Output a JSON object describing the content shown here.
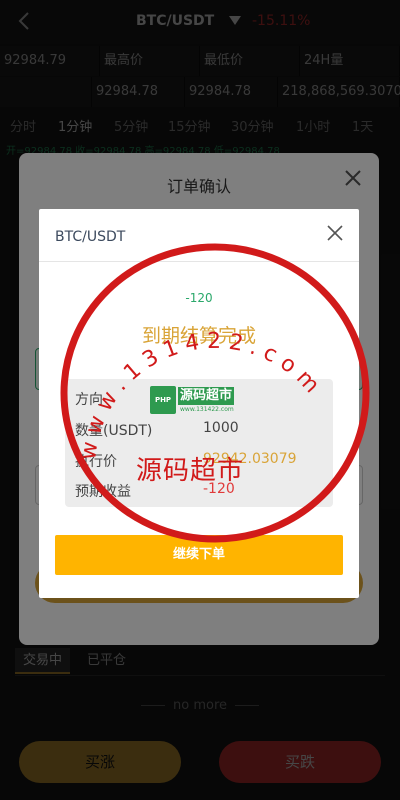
{
  "header": {
    "pair": "BTC/USDT",
    "change": "-15.11%"
  },
  "stats_row1": [
    "92984.79",
    "最高价",
    "最低价",
    "24H量"
  ],
  "stats_row2": [
    "92984.78",
    "92984.78",
    "218,868,569.3070"
  ],
  "periods": [
    "分时",
    "1分钟",
    "5分钟",
    "15分钟",
    "30分钟",
    "1小时",
    "1天"
  ],
  "active_period": "1分钟",
  "ma_row": "开=92984.78   收=92984.78   高=92984.78   低=92984.78",
  "confirm_modal": {
    "title": "订单确认"
  },
  "result_modal": {
    "title": "BTC/USDT",
    "profit_small": "-120",
    "status": "到期结算完成",
    "details": {
      "direction_label": "方向",
      "quantity_label": "数量(USDT)",
      "quantity_value": "1000",
      "price_label": "执行价",
      "price_value": "92942.03079",
      "profit_label": "预期收益",
      "profit_value": "-120"
    },
    "continue_label": "继续下单"
  },
  "orders": {
    "tab_trading": "交易中",
    "tab_closed": "已平仓",
    "no_more": "no more"
  },
  "bottom": {
    "buy_up": "买涨",
    "buy_down": "买跌"
  },
  "watermark": {
    "arc_text": "w w w . 1 3 1 4 2 2 . c o m",
    "badge_php": "PHP",
    "badge_name": "源码超市",
    "badge_url": "www.131422.com",
    "big_text": "源码超市"
  },
  "colors": {
    "gold": "#d9a437",
    "red": "#e03a3a",
    "green": "#2ba86b",
    "stamp_red": "#d11a1a"
  }
}
